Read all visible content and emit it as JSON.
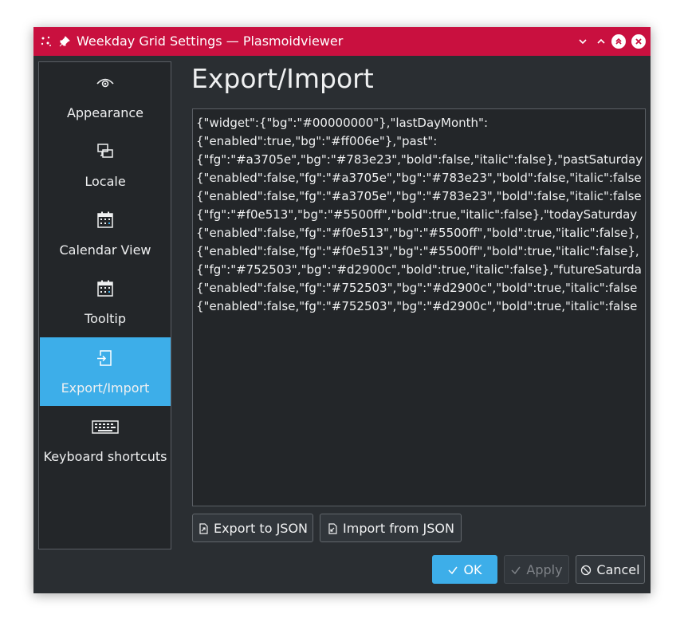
{
  "window": {
    "title": "Weekday Grid Settings — Plasmoidviewer"
  },
  "sidebar": {
    "items": [
      {
        "label": "Appearance",
        "icon": "eye-icon"
      },
      {
        "label": "Locale",
        "icon": "locale-icon"
      },
      {
        "label": "Calendar View",
        "icon": "calendar-icon"
      },
      {
        "label": "Tooltip",
        "icon": "calendar-icon"
      },
      {
        "label": "Export/Import",
        "icon": "export-icon",
        "active": true
      },
      {
        "label": "Keyboard shortcuts",
        "icon": "keyboard-icon"
      }
    ]
  },
  "page": {
    "title": "Export/Import",
    "json_lines": [
      "{\"widget\":{\"bg\":\"#00000000\"},\"lastDayMonth\":",
      "{\"enabled\":true,\"bg\":\"#ff006e\"},\"past\":",
      "{\"fg\":\"#a3705e\",\"bg\":\"#783e23\",\"bold\":false,\"italic\":false},\"pastSaturday",
      "{\"enabled\":false,\"fg\":\"#a3705e\",\"bg\":\"#783e23\",\"bold\":false,\"italic\":false",
      "{\"enabled\":false,\"fg\":\"#a3705e\",\"bg\":\"#783e23\",\"bold\":false,\"italic\":false",
      "{\"fg\":\"#f0e513\",\"bg\":\"#5500ff\",\"bold\":true,\"italic\":false},\"todaySaturday",
      "{\"enabled\":false,\"fg\":\"#f0e513\",\"bg\":\"#5500ff\",\"bold\":true,\"italic\":false},",
      "{\"enabled\":false,\"fg\":\"#f0e513\",\"bg\":\"#5500ff\",\"bold\":true,\"italic\":false},",
      "{\"fg\":\"#752503\",\"bg\":\"#d2900c\",\"bold\":true,\"italic\":false},\"futureSaturda",
      "{\"enabled\":false,\"fg\":\"#752503\",\"bg\":\"#d2900c\",\"bold\":true,\"italic\":false",
      "{\"enabled\":false,\"fg\":\"#752503\",\"bg\":\"#d2900c\",\"bold\":true,\"italic\":false"
    ],
    "export_label": "Export to JSON",
    "import_label": "Import from JSON"
  },
  "footer": {
    "ok_label": "OK",
    "apply_label": "Apply",
    "cancel_label": "Cancel"
  },
  "colors": {
    "titlebar": "#c9103f",
    "accent": "#3daee9",
    "window_bg": "#2a2e32",
    "view_bg": "#232629",
    "text": "#eff0f1"
  }
}
